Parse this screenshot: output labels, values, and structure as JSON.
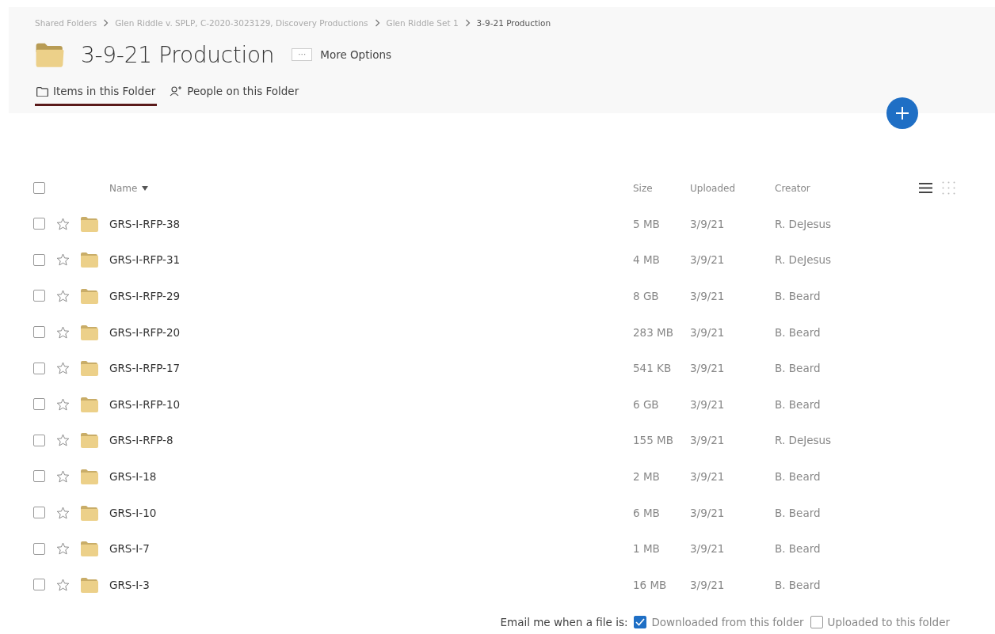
{
  "breadcrumb": [
    "Shared Folders",
    "Glen Riddle v. SPLP, C-2020-3023129, Discovery Productions",
    "Glen Riddle Set 1",
    "3-9-21 Production"
  ],
  "title": "3-9-21 Production",
  "more_options": {
    "icon": "···",
    "label": "More Options"
  },
  "tabs": [
    {
      "label": "Items in this Folder",
      "kind": "folder",
      "selected": true
    },
    {
      "label": "People on this Folder",
      "kind": "people",
      "selected": false
    }
  ],
  "table": {
    "select_all": {
      "checked": false
    },
    "columns": [
      {
        "label": "Name",
        "sorted": true
      },
      {
        "label": "Size",
        "sorted": false
      },
      {
        "label": "Uploaded",
        "sorted": false
      },
      {
        "label": "Creator",
        "sorted": false
      }
    ],
    "views": [
      {
        "kind": "list",
        "selected": true
      },
      {
        "kind": "grid",
        "selected": false
      }
    ],
    "rows": [
      {
        "name": "GRS-I-RFP-38",
        "size": "5 MB",
        "uploaded": "3/9/21",
        "creator": "R. DeJesus",
        "checked": false,
        "starred": false
      },
      {
        "name": "GRS-I-RFP-31",
        "size": "4 MB",
        "uploaded": "3/9/21",
        "creator": "R. DeJesus",
        "checked": false,
        "starred": false
      },
      {
        "name": "GRS-I-RFP-29",
        "size": "8 GB",
        "uploaded": "3/9/21",
        "creator": "B. Beard",
        "checked": false,
        "starred": false
      },
      {
        "name": "GRS-I-RFP-20",
        "size": "283 MB",
        "uploaded": "3/9/21",
        "creator": "B. Beard",
        "checked": false,
        "starred": false
      },
      {
        "name": "GRS-I-RFP-17",
        "size": "541 KB",
        "uploaded": "3/9/21",
        "creator": "B. Beard",
        "checked": false,
        "starred": false
      },
      {
        "name": "GRS-I-RFP-10",
        "size": "6 GB",
        "uploaded": "3/9/21",
        "creator": "B. Beard",
        "checked": false,
        "starred": false
      },
      {
        "name": "GRS-I-RFP-8",
        "size": "155 MB",
        "uploaded": "3/9/21",
        "creator": "R. DeJesus",
        "checked": false,
        "starred": false
      },
      {
        "name": "GRS-I-18",
        "size": "2 MB",
        "uploaded": "3/9/21",
        "creator": "B. Beard",
        "checked": false,
        "starred": false
      },
      {
        "name": "GRS-I-10",
        "size": "6 MB",
        "uploaded": "3/9/21",
        "creator": "B. Beard",
        "checked": false,
        "starred": false
      },
      {
        "name": "GRS-I-7",
        "size": "1 MB",
        "uploaded": "3/9/21",
        "creator": "B. Beard",
        "checked": false,
        "starred": false
      },
      {
        "name": "GRS-I-3",
        "size": "16 MB",
        "uploaded": "3/9/21",
        "creator": "B. Beard",
        "checked": false,
        "starred": false
      }
    ]
  },
  "email": {
    "label": "Email me when a file is:",
    "options": [
      {
        "label": "Downloaded from this folder",
        "checked": true
      },
      {
        "label": "Uploaded to this folder",
        "checked": false
      }
    ]
  }
}
